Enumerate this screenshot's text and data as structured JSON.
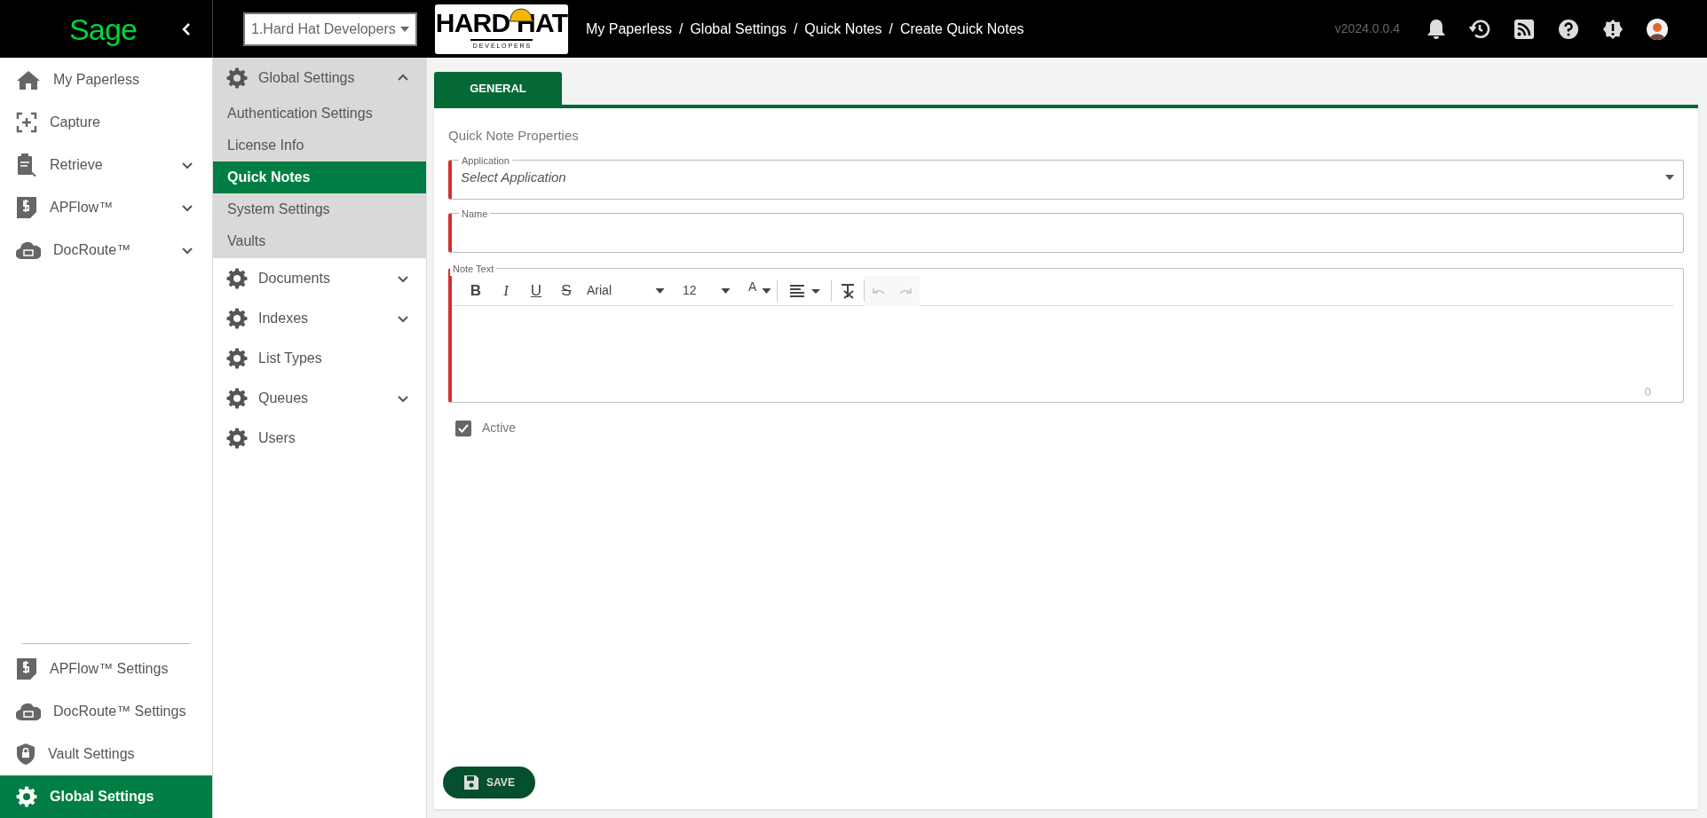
{
  "top_bar": {
    "logo": "Sage",
    "company_select": {
      "value": "1.Hard Hat Developers"
    },
    "brand_logo": {
      "line_1": "HARD HAT",
      "line_2": "D E V E L O P E R S"
    },
    "breadcrumb": [
      {
        "label": "My Paperless"
      },
      {
        "separator": "/",
        "label": "Global Settings"
      },
      {
        "separator": "/",
        "label": "Quick Notes"
      },
      {
        "separator": "/",
        "label": "Create Quick Notes"
      }
    ],
    "version": "v2024.0.0.4"
  },
  "nav": {
    "items": [
      {
        "label": "My Paperless",
        "kind": "home",
        "expandable": false,
        "selected": false
      },
      {
        "label": "Capture",
        "kind": "capture",
        "expandable": false,
        "selected": false
      },
      {
        "label": "Retrieve",
        "kind": "retrieve",
        "expandable": true,
        "selected": false
      },
      {
        "label": "APFlow™",
        "kind": "apflow",
        "expandable": true,
        "selected": false
      },
      {
        "label": "DocRoute™",
        "kind": "docroute",
        "expandable": true,
        "selected": false
      }
    ],
    "bottom_items": [
      {
        "label": "APFlow™ Settings",
        "kind": "apflow",
        "selected": false
      },
      {
        "label": "DocRoute™ Settings",
        "kind": "docroute",
        "selected": false
      },
      {
        "label": "Vault Settings",
        "kind": "vault",
        "selected": false
      },
      {
        "label": "Global Settings",
        "kind": "gear",
        "selected": true
      }
    ]
  },
  "settings_menu": [
    {
      "label": "Global Settings",
      "expandable": true,
      "expanded": true,
      "children": [
        {
          "label": "Authentication Settings",
          "selected": false
        },
        {
          "label": "License Info",
          "selected": false
        },
        {
          "label": "Quick Notes",
          "selected": true
        },
        {
          "label": "System Settings",
          "selected": false
        },
        {
          "label": "Vaults",
          "selected": false
        }
      ]
    },
    {
      "label": "Documents",
      "expandable": true,
      "expanded": false
    },
    {
      "label": "Indexes",
      "expandable": true,
      "expanded": false
    },
    {
      "label": "List Types",
      "expandable": false,
      "expanded": false
    },
    {
      "label": "Queues",
      "expandable": true,
      "expanded": false
    },
    {
      "label": "Users",
      "expandable": false,
      "expanded": false
    }
  ],
  "tabs": [
    {
      "label": "GENERAL",
      "selected": true
    }
  ],
  "form": {
    "title": "Quick Note Properties",
    "application": {
      "label": "Application",
      "placeholder": "Select Application",
      "required": true
    },
    "name": {
      "label": "Name",
      "required": true
    },
    "note_text": {
      "label": "Note Text",
      "required": true,
      "format_buttons": [
        {
          "label": "B",
          "kind": "bold"
        },
        {
          "label": "I",
          "kind": "italic"
        },
        {
          "label": "U",
          "kind": "underline"
        },
        {
          "label": "S",
          "kind": "strike"
        }
      ],
      "font": "Arial",
      "font_size": "12",
      "font_color": "A",
      "counter": "0"
    },
    "active": {
      "label": "Active",
      "checked": true
    },
    "save_button": "SAVE"
  }
}
